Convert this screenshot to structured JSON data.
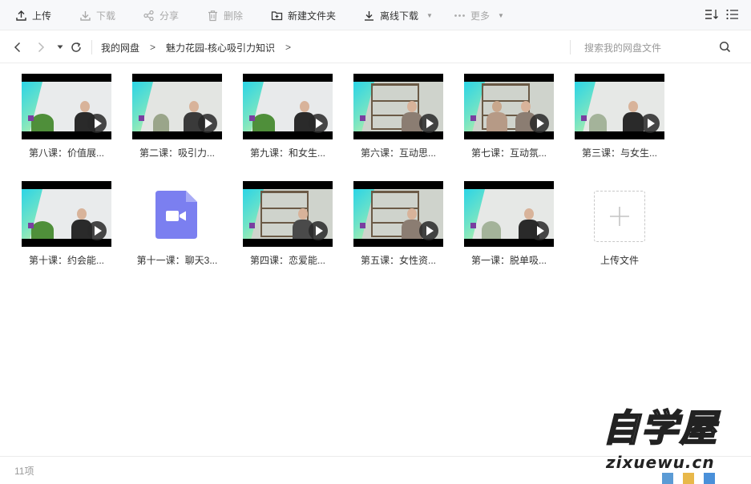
{
  "toolbar": {
    "upload": "上传",
    "download": "下载",
    "share": "分享",
    "delete": "删除",
    "new_folder": "新建文件夹",
    "offline_download": "离线下载",
    "more": "更多"
  },
  "nav": {
    "breadcrumbs": [
      "我的网盘",
      "魅力花园-核心吸引力知识"
    ],
    "crumb_sep": ">",
    "search_placeholder": "搜索我的网盘文件"
  },
  "files": [
    {
      "name": "第八课：价值展...",
      "type": "video"
    },
    {
      "name": "第二课：吸引力...",
      "type": "video"
    },
    {
      "name": "第九课：和女生...",
      "type": "video"
    },
    {
      "name": "第六课：互动思...",
      "type": "video"
    },
    {
      "name": "第七课：互动氛...",
      "type": "video"
    },
    {
      "name": "第三课：与女生...",
      "type": "video"
    },
    {
      "name": "第十课：约会能...",
      "type": "video"
    },
    {
      "name": "第十一课：聊天3...",
      "type": "video-file"
    },
    {
      "name": "第四课：恋爱能...",
      "type": "video"
    },
    {
      "name": "第五课：女性资...",
      "type": "video"
    },
    {
      "name": "第一课：脱单吸...",
      "type": "video"
    }
  ],
  "upload_tile": {
    "label": "上传文件"
  },
  "footer": {
    "count": "11项"
  },
  "watermark": {
    "title": "自学屋",
    "site": "zixuewu.cn"
  },
  "colors": {
    "video_file_icon": "#7b7ff0",
    "accent": "#333333"
  }
}
